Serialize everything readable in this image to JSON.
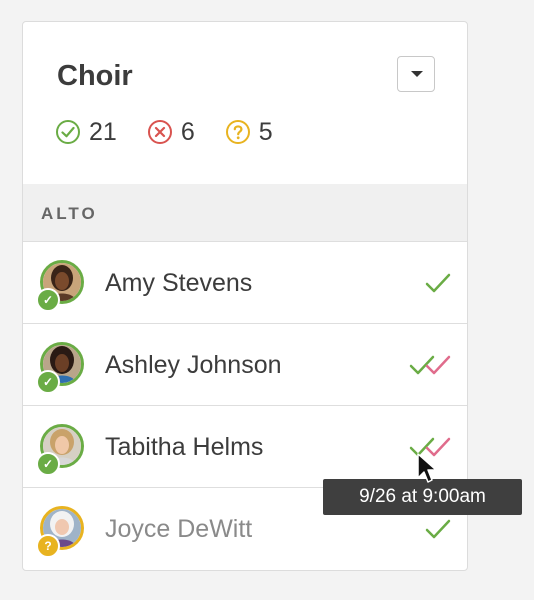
{
  "group": {
    "title": "Choir"
  },
  "stats": {
    "accepted": "21",
    "declined": "6",
    "pending": "5"
  },
  "section": {
    "label": "ALTO"
  },
  "members": [
    {
      "name": "Amy Stevens",
      "status": "accepted"
    },
    {
      "name": "Ashley Johnson",
      "status": "accepted"
    },
    {
      "name": "Tabitha Helms",
      "status": "accepted"
    },
    {
      "name": "Joyce DeWitt",
      "status": "pending"
    }
  ],
  "tooltip": {
    "text": "9/26 at 9:00am"
  },
  "colors": {
    "accepted": "#6aac45",
    "declined": "#d9534f",
    "pending": "#e8b320",
    "read": "#e06c8c"
  }
}
